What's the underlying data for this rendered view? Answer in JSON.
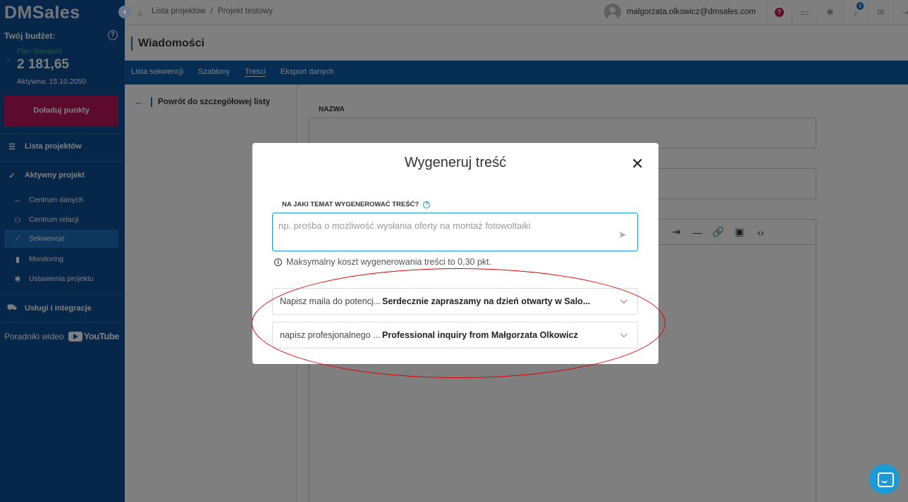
{
  "sidebar": {
    "logo": "DMSales",
    "budget_label": "Twój budżet:",
    "plan_name": "Plan Standard",
    "budget_value": "2 181,65",
    "active_until": "Aktywna: 15.10.2050",
    "topup_label": "Doładuj punkty",
    "items": [
      {
        "label": "Lista projektów"
      },
      {
        "label": "Aktywny projekt"
      },
      {
        "label": "Centrum danych"
      },
      {
        "label": "Centrum relacji"
      },
      {
        "label": "Sekwencje"
      },
      {
        "label": "Monitoring"
      },
      {
        "label": "Ustawienia projektu"
      },
      {
        "label": "Usługi i integracje"
      }
    ],
    "video_label": "Poradniki wideo",
    "youtube_label": "YouTube"
  },
  "topbar": {
    "breadcrumb": [
      "Lista projektów",
      "Projekt testowy"
    ],
    "user_email": "malgorzata.olkowicz@dmsales.com",
    "notification_count": "8"
  },
  "page": {
    "title": "Wiadomości",
    "tabs": [
      "Lista sekwencji",
      "Szablony",
      "Treści",
      "Eksport danych"
    ],
    "back_link": "Powrót do szczegółowej listy",
    "name_label": "NAZWA"
  },
  "modal": {
    "title": "Wygeneruj treść",
    "topic_label": "NA JAKI TEMAT WYGENEROWAĆ TREŚĆ?",
    "topic_placeholder": "np. prośba o możliwość wysłania oferty na montaż fotowoltaiki",
    "cost_note": "Maksymalny koszt wygenerowania treści to 0,30 pkt.",
    "history": [
      {
        "prompt": "Napisz maila do potencj...",
        "result": "Serdecznie zapraszamy na dzień otwarty w Salo..."
      },
      {
        "prompt": "napisz profesjonalnego ...",
        "result": "Professional inquiry from Małgorzata Olkowicz"
      }
    ]
  },
  "colors": {
    "sidebar_bg": "#0d4f93",
    "tabbar_bg": "#0d5aa8",
    "accent": "#1b9ad6",
    "topup": "#b8165a",
    "annotation": "#e00000"
  }
}
